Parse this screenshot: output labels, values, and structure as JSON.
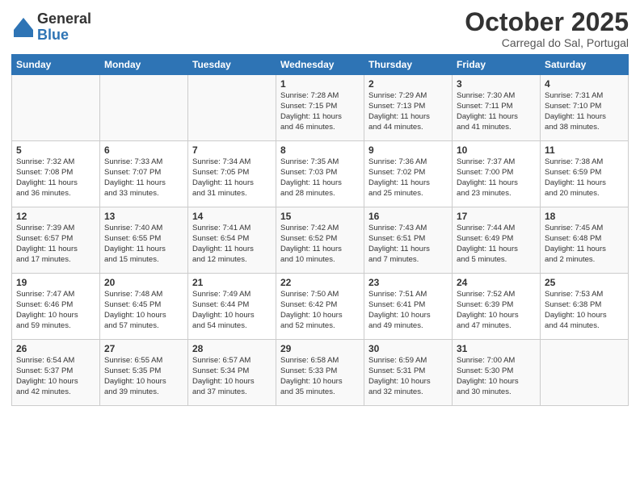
{
  "logo": {
    "general": "General",
    "blue": "Blue"
  },
  "header": {
    "title": "October 2025",
    "location": "Carregal do Sal, Portugal"
  },
  "columns": [
    "Sunday",
    "Monday",
    "Tuesday",
    "Wednesday",
    "Thursday",
    "Friday",
    "Saturday"
  ],
  "weeks": [
    [
      {
        "day": "",
        "info": ""
      },
      {
        "day": "",
        "info": ""
      },
      {
        "day": "",
        "info": ""
      },
      {
        "day": "1",
        "info": "Sunrise: 7:28 AM\nSunset: 7:15 PM\nDaylight: 11 hours\nand 46 minutes."
      },
      {
        "day": "2",
        "info": "Sunrise: 7:29 AM\nSunset: 7:13 PM\nDaylight: 11 hours\nand 44 minutes."
      },
      {
        "day": "3",
        "info": "Sunrise: 7:30 AM\nSunset: 7:11 PM\nDaylight: 11 hours\nand 41 minutes."
      },
      {
        "day": "4",
        "info": "Sunrise: 7:31 AM\nSunset: 7:10 PM\nDaylight: 11 hours\nand 38 minutes."
      }
    ],
    [
      {
        "day": "5",
        "info": "Sunrise: 7:32 AM\nSunset: 7:08 PM\nDaylight: 11 hours\nand 36 minutes."
      },
      {
        "day": "6",
        "info": "Sunrise: 7:33 AM\nSunset: 7:07 PM\nDaylight: 11 hours\nand 33 minutes."
      },
      {
        "day": "7",
        "info": "Sunrise: 7:34 AM\nSunset: 7:05 PM\nDaylight: 11 hours\nand 31 minutes."
      },
      {
        "day": "8",
        "info": "Sunrise: 7:35 AM\nSunset: 7:03 PM\nDaylight: 11 hours\nand 28 minutes."
      },
      {
        "day": "9",
        "info": "Sunrise: 7:36 AM\nSunset: 7:02 PM\nDaylight: 11 hours\nand 25 minutes."
      },
      {
        "day": "10",
        "info": "Sunrise: 7:37 AM\nSunset: 7:00 PM\nDaylight: 11 hours\nand 23 minutes."
      },
      {
        "day": "11",
        "info": "Sunrise: 7:38 AM\nSunset: 6:59 PM\nDaylight: 11 hours\nand 20 minutes."
      }
    ],
    [
      {
        "day": "12",
        "info": "Sunrise: 7:39 AM\nSunset: 6:57 PM\nDaylight: 11 hours\nand 17 minutes."
      },
      {
        "day": "13",
        "info": "Sunrise: 7:40 AM\nSunset: 6:55 PM\nDaylight: 11 hours\nand 15 minutes."
      },
      {
        "day": "14",
        "info": "Sunrise: 7:41 AM\nSunset: 6:54 PM\nDaylight: 11 hours\nand 12 minutes."
      },
      {
        "day": "15",
        "info": "Sunrise: 7:42 AM\nSunset: 6:52 PM\nDaylight: 11 hours\nand 10 minutes."
      },
      {
        "day": "16",
        "info": "Sunrise: 7:43 AM\nSunset: 6:51 PM\nDaylight: 11 hours\nand 7 minutes."
      },
      {
        "day": "17",
        "info": "Sunrise: 7:44 AM\nSunset: 6:49 PM\nDaylight: 11 hours\nand 5 minutes."
      },
      {
        "day": "18",
        "info": "Sunrise: 7:45 AM\nSunset: 6:48 PM\nDaylight: 11 hours\nand 2 minutes."
      }
    ],
    [
      {
        "day": "19",
        "info": "Sunrise: 7:47 AM\nSunset: 6:46 PM\nDaylight: 10 hours\nand 59 minutes."
      },
      {
        "day": "20",
        "info": "Sunrise: 7:48 AM\nSunset: 6:45 PM\nDaylight: 10 hours\nand 57 minutes."
      },
      {
        "day": "21",
        "info": "Sunrise: 7:49 AM\nSunset: 6:44 PM\nDaylight: 10 hours\nand 54 minutes."
      },
      {
        "day": "22",
        "info": "Sunrise: 7:50 AM\nSunset: 6:42 PM\nDaylight: 10 hours\nand 52 minutes."
      },
      {
        "day": "23",
        "info": "Sunrise: 7:51 AM\nSunset: 6:41 PM\nDaylight: 10 hours\nand 49 minutes."
      },
      {
        "day": "24",
        "info": "Sunrise: 7:52 AM\nSunset: 6:39 PM\nDaylight: 10 hours\nand 47 minutes."
      },
      {
        "day": "25",
        "info": "Sunrise: 7:53 AM\nSunset: 6:38 PM\nDaylight: 10 hours\nand 44 minutes."
      }
    ],
    [
      {
        "day": "26",
        "info": "Sunrise: 6:54 AM\nSunset: 5:37 PM\nDaylight: 10 hours\nand 42 minutes."
      },
      {
        "day": "27",
        "info": "Sunrise: 6:55 AM\nSunset: 5:35 PM\nDaylight: 10 hours\nand 39 minutes."
      },
      {
        "day": "28",
        "info": "Sunrise: 6:57 AM\nSunset: 5:34 PM\nDaylight: 10 hours\nand 37 minutes."
      },
      {
        "day": "29",
        "info": "Sunrise: 6:58 AM\nSunset: 5:33 PM\nDaylight: 10 hours\nand 35 minutes."
      },
      {
        "day": "30",
        "info": "Sunrise: 6:59 AM\nSunset: 5:31 PM\nDaylight: 10 hours\nand 32 minutes."
      },
      {
        "day": "31",
        "info": "Sunrise: 7:00 AM\nSunset: 5:30 PM\nDaylight: 10 hours\nand 30 minutes."
      },
      {
        "day": "",
        "info": ""
      }
    ]
  ]
}
